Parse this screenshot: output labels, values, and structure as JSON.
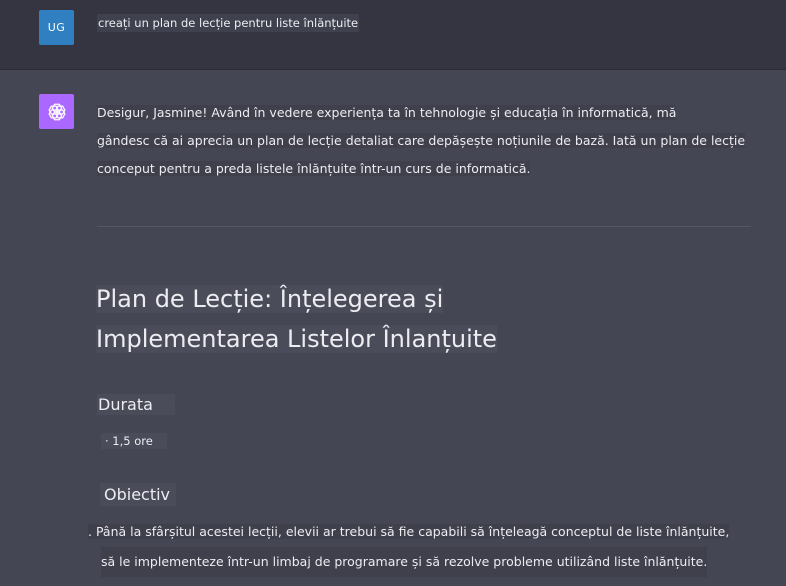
{
  "user": {
    "initials": "UG",
    "message": "creați un plan de lecție pentru liste înlănțuite"
  },
  "assistant": {
    "intro_line1": "Desigur, Jasmine! Având în vedere experiența ta în tehnologie și educația în informatică, mă",
    "intro_line2": "gândesc că ai aprecia un plan de lecție detaliat care depășește noțiunile de bază. Iată un plan de lecție",
    "intro_line3": "conceput pentru a preda listele înlănțuite într-un curs de informatică.",
    "title_line1": "Plan de Lecție: Înțelegerea și",
    "title_line2": "Implementarea Listelor Înlanțuite",
    "duration_heading": "Durata",
    "duration_item": "· 1,5 ore",
    "objective_heading": "Obiectiv",
    "objective_line1": ". Până la sfârșitul acestei lecții, elevii ar trebui să fie capabili să înțeleagă conceptul de liste înlănțuite,",
    "objective_line2": "să le implementeze într-un limbaj de programare și să rezolve probleme utilizând liste înlănțuite."
  },
  "colors": {
    "user_avatar": "#2f7fc1",
    "bot_avatar": "#ab68ff",
    "user_row_bg": "#343541",
    "assistant_bg": "#444654"
  },
  "icons": {
    "bot_avatar": "openai-logo-icon"
  }
}
